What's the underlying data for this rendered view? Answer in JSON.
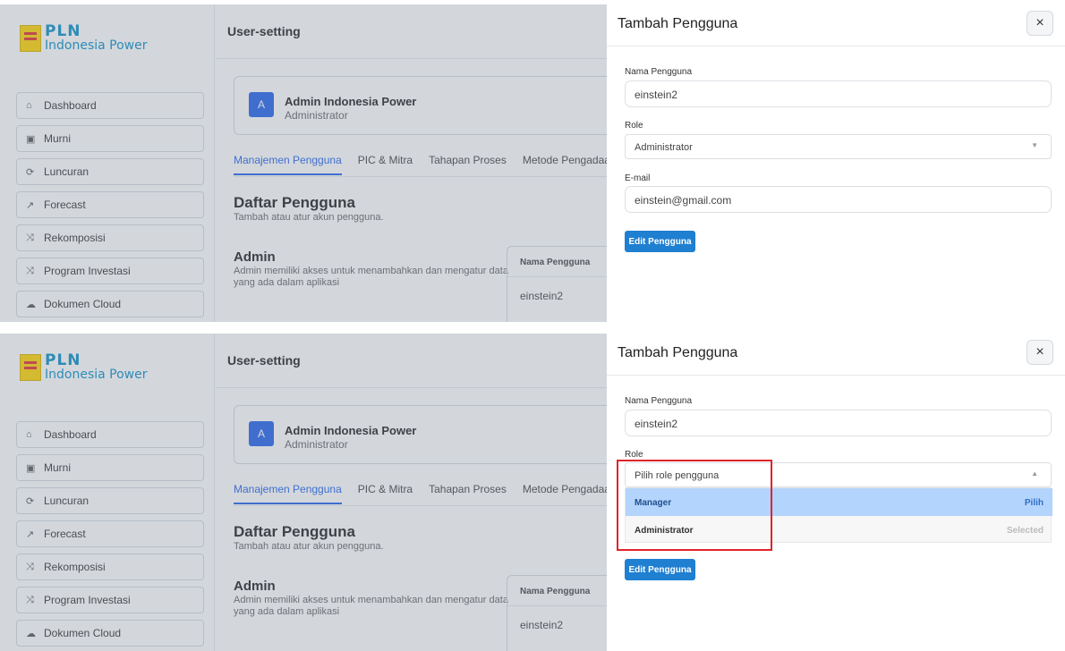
{
  "brand": {
    "name": "PLN",
    "subtitle": "Indonesia Power"
  },
  "sidebar": {
    "items": [
      {
        "label": "Dashboard",
        "icon": "home-icon",
        "glyph": "⌂"
      },
      {
        "label": "Murni",
        "icon": "file-plus-icon",
        "glyph": "▣"
      },
      {
        "label": "Luncuran",
        "icon": "refresh-icon",
        "glyph": "⟳"
      },
      {
        "label": "Forecast",
        "icon": "trend-chart-icon",
        "glyph": "↗"
      },
      {
        "label": "Rekomposisi",
        "icon": "shuffle-icon",
        "glyph": "⤨"
      },
      {
        "label": "Program Investasi",
        "icon": "shuffle-icon",
        "glyph": "⤨"
      },
      {
        "label": "Dokumen Cloud",
        "icon": "cloud-icon",
        "glyph": "☁"
      }
    ]
  },
  "main": {
    "title": "User-setting",
    "user": {
      "initial": "A",
      "name": "Admin Indonesia Power",
      "role": "Administrator"
    },
    "tabs": [
      {
        "label": "Manajemen Pengguna",
        "active": true
      },
      {
        "label": "PIC & Mitra"
      },
      {
        "label": "Tahapan Proses"
      },
      {
        "label": "Metode Pengadaa"
      }
    ],
    "section_title": "Daftar Pengguna",
    "section_subtitle": "Tambah atau atur akun pengguna.",
    "admin_title": "Admin",
    "admin_desc": "Admin memiliki akses untuk menambahkan dan mengatur data yang ada dalam aplikasi",
    "table": {
      "header": "Nama Pengguna",
      "rows": [
        "einstein2"
      ]
    }
  },
  "modal": {
    "title": "Tambah Pengguna",
    "close_glyph": "×",
    "name_label": "Nama Pengguna",
    "name_value": "einstein2",
    "role_label": "Role",
    "role_value": "Administrator",
    "role_placeholder": "Pilih role pengguna",
    "email_label": "E-mail",
    "email_value": "einstein@gmail.com",
    "submit_label": "Edit Pengguna",
    "arrow_down": "▼",
    "arrow_up": "▲",
    "options": [
      {
        "label": "Manager",
        "hint": "Pilih"
      },
      {
        "label": "Administrator",
        "hint": "Selected"
      }
    ]
  },
  "colors": {
    "accent": "#1f7fd1",
    "tab_active": "#2563eb",
    "highlight": "#b3d4fc",
    "annotation": "#e0242a"
  }
}
